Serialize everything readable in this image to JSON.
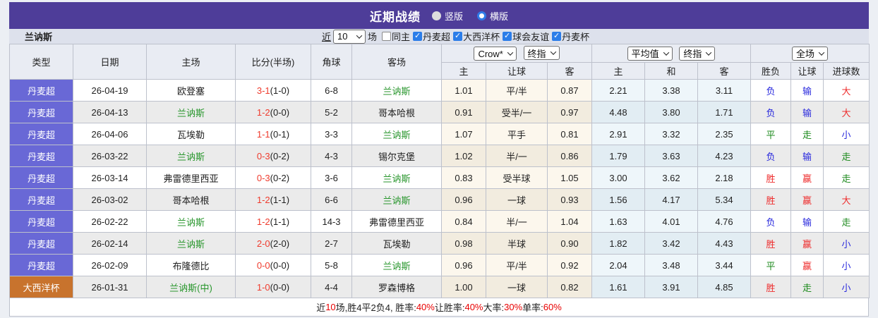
{
  "colors": {
    "red": "#EE2C2C",
    "blue": "#2929DD",
    "green": "#1D8A1D",
    "accent_purple": "#4E3D99",
    "indigo_cell": "#6968D6",
    "orange_cell": "#C8732D"
  },
  "title_bar": {
    "title": "近期战绩",
    "radios": [
      {
        "label": "竖版",
        "checked": false
      },
      {
        "label": "横版",
        "checked": true
      }
    ]
  },
  "filter_bar": {
    "team": "兰讷斯",
    "near_label": "近",
    "count_value": "10",
    "count_suffix": "场",
    "checkboxes": [
      {
        "label": "同主",
        "checked": false
      },
      {
        "label": "丹麦超",
        "checked": true
      },
      {
        "label": "大西洋杯",
        "checked": true
      },
      {
        "label": "球会友谊",
        "checked": true
      },
      {
        "label": "丹麦杯",
        "checked": true
      }
    ]
  },
  "table": {
    "left_headers": [
      "类型",
      "日期",
      "主场",
      "比分(半场)",
      "角球",
      "客场"
    ],
    "selects": {
      "odds_source": "Crow*",
      "odds_stage": "终指",
      "avg_source": "平均值",
      "avg_stage": "终指",
      "scope": "全场"
    },
    "sub_headers": [
      "主",
      "让球",
      "客",
      "主",
      "和",
      "客",
      "胜负",
      "让球",
      "进球数"
    ],
    "rows": [
      {
        "type": "丹麦超",
        "type_style": "indigo",
        "date": "26-04-19",
        "home": "欧登塞",
        "home_green": false,
        "score": "3-1",
        "half": "(1-0)",
        "corner": "6-8",
        "away": "兰讷斯",
        "away_green": true,
        "odds1": [
          "1.01",
          "平/半",
          "0.87"
        ],
        "odds2": [
          "2.21",
          "3.38",
          "3.11"
        ],
        "results": [
          {
            "t": "负",
            "c": "blue"
          },
          {
            "t": "输",
            "c": "blue"
          },
          {
            "t": "大",
            "c": "red"
          }
        ]
      },
      {
        "type": "丹麦超",
        "type_style": "indigo",
        "date": "26-04-13",
        "home": "兰讷斯",
        "home_green": true,
        "score": "1-2",
        "half": "(0-0)",
        "corner": "5-2",
        "away": "哥本哈根",
        "away_green": false,
        "odds1": [
          "0.91",
          "受半/一",
          "0.97"
        ],
        "odds2": [
          "4.48",
          "3.80",
          "1.71"
        ],
        "results": [
          {
            "t": "负",
            "c": "blue"
          },
          {
            "t": "输",
            "c": "blue"
          },
          {
            "t": "大",
            "c": "red"
          }
        ]
      },
      {
        "type": "丹麦超",
        "type_style": "indigo",
        "date": "26-04-06",
        "home": "瓦埃勒",
        "home_green": false,
        "score": "1-1",
        "half": "(0-1)",
        "corner": "3-3",
        "away": "兰讷斯",
        "away_green": true,
        "odds1": [
          "1.07",
          "平手",
          "0.81"
        ],
        "odds2": [
          "2.91",
          "3.32",
          "2.35"
        ],
        "results": [
          {
            "t": "平",
            "c": "green"
          },
          {
            "t": "走",
            "c": "green"
          },
          {
            "t": "小",
            "c": "blue"
          }
        ]
      },
      {
        "type": "丹麦超",
        "type_style": "indigo",
        "date": "26-03-22",
        "home": "兰讷斯",
        "home_green": true,
        "score": "0-3",
        "half": "(0-2)",
        "corner": "4-3",
        "away": "锡尔克堡",
        "away_green": false,
        "odds1": [
          "1.02",
          "半/一",
          "0.86"
        ],
        "odds2": [
          "1.79",
          "3.63",
          "4.23"
        ],
        "results": [
          {
            "t": "负",
            "c": "blue"
          },
          {
            "t": "输",
            "c": "blue"
          },
          {
            "t": "走",
            "c": "green"
          }
        ]
      },
      {
        "type": "丹麦超",
        "type_style": "indigo",
        "date": "26-03-14",
        "home": "弗雷德里西亚",
        "home_green": false,
        "score": "0-3",
        "half": "(0-2)",
        "corner": "3-6",
        "away": "兰讷斯",
        "away_green": true,
        "odds1": [
          "0.83",
          "受半球",
          "1.05"
        ],
        "odds2": [
          "3.00",
          "3.62",
          "2.18"
        ],
        "results": [
          {
            "t": "胜",
            "c": "red"
          },
          {
            "t": "赢",
            "c": "red"
          },
          {
            "t": "走",
            "c": "green"
          }
        ]
      },
      {
        "type": "丹麦超",
        "type_style": "indigo",
        "date": "26-03-02",
        "home": "哥本哈根",
        "home_green": false,
        "score": "1-2",
        "half": "(1-1)",
        "corner": "6-6",
        "away": "兰讷斯",
        "away_green": true,
        "odds1": [
          "0.96",
          "一球",
          "0.93"
        ],
        "odds2": [
          "1.56",
          "4.17",
          "5.34"
        ],
        "results": [
          {
            "t": "胜",
            "c": "red"
          },
          {
            "t": "赢",
            "c": "red"
          },
          {
            "t": "大",
            "c": "red"
          }
        ]
      },
      {
        "type": "丹麦超",
        "type_style": "indigo",
        "date": "26-02-22",
        "home": "兰讷斯",
        "home_green": true,
        "score": "1-2",
        "half": "(1-1)",
        "corner": "14-3",
        "away": "弗雷德里西亚",
        "away_green": false,
        "odds1": [
          "0.84",
          "半/一",
          "1.04"
        ],
        "odds2": [
          "1.63",
          "4.01",
          "4.76"
        ],
        "results": [
          {
            "t": "负",
            "c": "blue"
          },
          {
            "t": "输",
            "c": "blue"
          },
          {
            "t": "走",
            "c": "green"
          }
        ]
      },
      {
        "type": "丹麦超",
        "type_style": "indigo",
        "date": "26-02-14",
        "home": "兰讷斯",
        "home_green": true,
        "score": "2-0",
        "half": "(2-0)",
        "corner": "2-7",
        "away": "瓦埃勒",
        "away_green": false,
        "odds1": [
          "0.98",
          "半球",
          "0.90"
        ],
        "odds2": [
          "1.82",
          "3.42",
          "4.43"
        ],
        "results": [
          {
            "t": "胜",
            "c": "red"
          },
          {
            "t": "赢",
            "c": "red"
          },
          {
            "t": "小",
            "c": "blue"
          }
        ]
      },
      {
        "type": "丹麦超",
        "type_style": "indigo",
        "date": "26-02-09",
        "home": "布隆德比",
        "home_green": false,
        "score": "0-0",
        "half": "(0-0)",
        "corner": "5-8",
        "away": "兰讷斯",
        "away_green": true,
        "odds1": [
          "0.96",
          "平/半",
          "0.92"
        ],
        "odds2": [
          "2.04",
          "3.48",
          "3.44"
        ],
        "results": [
          {
            "t": "平",
            "c": "green"
          },
          {
            "t": "赢",
            "c": "red"
          },
          {
            "t": "小",
            "c": "blue"
          }
        ]
      },
      {
        "type": "大西洋杯",
        "type_style": "orange",
        "date": "26-01-31",
        "home": "兰讷斯(中)",
        "home_green": true,
        "score": "1-0",
        "half": "(0-0)",
        "corner": "4-4",
        "away": "罗森博格",
        "away_green": false,
        "odds1": [
          "1.00",
          "一球",
          "0.82"
        ],
        "odds2": [
          "1.61",
          "3.91",
          "4.85"
        ],
        "results": [
          {
            "t": "胜",
            "c": "red"
          },
          {
            "t": "走",
            "c": "green"
          },
          {
            "t": "小",
            "c": "blue"
          }
        ]
      }
    ],
    "footer_segments": [
      {
        "t": "近",
        "c": "black"
      },
      {
        "t": "10",
        "c": "red"
      },
      {
        "t": "场,胜4平2负4, 胜率:",
        "c": "black"
      },
      {
        "t": "40%",
        "c": "red"
      },
      {
        "t": " 让胜率:",
        "c": "black"
      },
      {
        "t": "40%",
        "c": "red"
      },
      {
        "t": " 大率:",
        "c": "black"
      },
      {
        "t": "30%",
        "c": "red"
      },
      {
        "t": " 单率:",
        "c": "black"
      },
      {
        "t": "60%",
        "c": "red"
      }
    ]
  }
}
